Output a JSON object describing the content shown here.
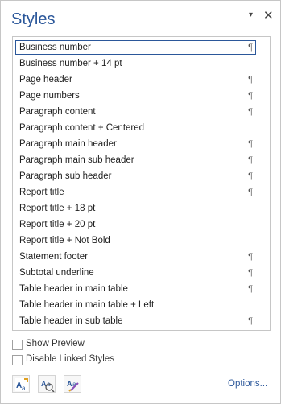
{
  "pane": {
    "title": "Styles",
    "menu_glyph": "▾",
    "close_glyph": "✕"
  },
  "styles": [
    {
      "name": "Business number",
      "pilcrow": "¶",
      "selected": true
    },
    {
      "name": "Business number + 14 pt",
      "pilcrow": "",
      "selected": false
    },
    {
      "name": "Page header",
      "pilcrow": "¶",
      "selected": false
    },
    {
      "name": "Page numbers",
      "pilcrow": "¶",
      "selected": false
    },
    {
      "name": "Paragraph content",
      "pilcrow": "¶",
      "selected": false
    },
    {
      "name": "Paragraph content + Centered",
      "pilcrow": "",
      "selected": false
    },
    {
      "name": "Paragraph main header",
      "pilcrow": "¶",
      "selected": false
    },
    {
      "name": "Paragraph main sub header",
      "pilcrow": "¶",
      "selected": false
    },
    {
      "name": "Paragraph sub header",
      "pilcrow": "¶",
      "selected": false
    },
    {
      "name": "Report title",
      "pilcrow": "¶",
      "selected": false
    },
    {
      "name": "Report title + 18 pt",
      "pilcrow": "",
      "selected": false
    },
    {
      "name": "Report title + 20 pt",
      "pilcrow": "",
      "selected": false
    },
    {
      "name": "Report title + Not Bold",
      "pilcrow": "",
      "selected": false
    },
    {
      "name": "Statement footer",
      "pilcrow": "¶",
      "selected": false
    },
    {
      "name": "Subtotal underline",
      "pilcrow": "¶",
      "selected": false
    },
    {
      "name": "Table header in main table",
      "pilcrow": "¶",
      "selected": false
    },
    {
      "name": "Table header in main table + Left",
      "pilcrow": "",
      "selected": false
    },
    {
      "name": "Table header in sub table",
      "pilcrow": "¶",
      "selected": false
    }
  ],
  "options": {
    "show_preview": {
      "label": "Show Preview",
      "checked": false
    },
    "disable_linked": {
      "label": "Disable Linked Styles",
      "checked": false
    }
  },
  "footer": {
    "buttons": [
      {
        "icon": "new-style-icon"
      },
      {
        "icon": "style-inspector-icon"
      },
      {
        "icon": "manage-styles-icon"
      }
    ],
    "options_link": "Options..."
  },
  "colors": {
    "accent": "#2b579a",
    "border": "#c6c6c6"
  }
}
